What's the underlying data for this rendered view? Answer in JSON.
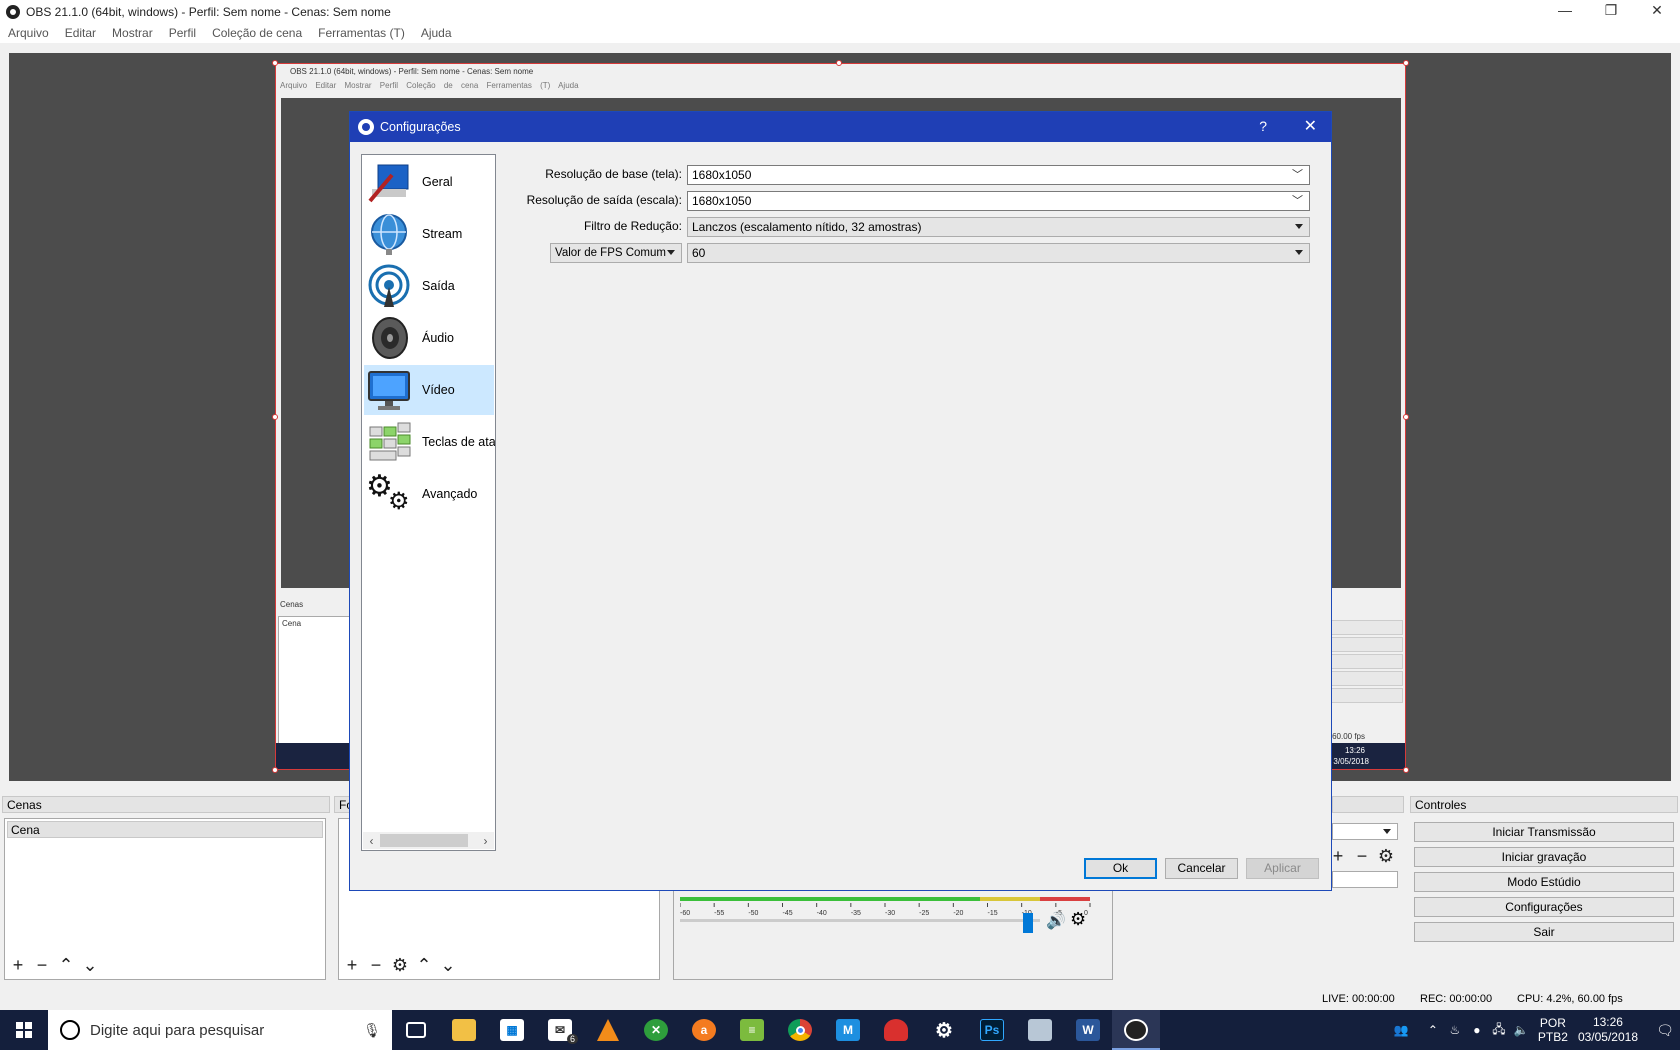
{
  "window": {
    "title": "OBS 21.1.0 (64bit, windows) - Perfil: Sem nome - Cenas: Sem nome",
    "controls": {
      "minimize": "—",
      "restore": "❐",
      "close": "✕"
    }
  },
  "menu": [
    "Arquivo",
    "Editar",
    "Mostrar",
    "Perfil",
    "Coleção de cena",
    "Ferramentas (T)",
    "Ajuda"
  ],
  "preview": {
    "nested_title": "OBS 21.1.0 (64bit, windows) - Perfil: Sem nome - Cenas: Sem nome",
    "nested_menu": "Arquivo Editar Mostrar Perfil Coleção de cena Ferramentas (T) Ajuda",
    "nested_scenes_label": "Cenas",
    "nested_scene_item": "Cena",
    "nested_time": "13:26",
    "nested_date": "3/05/2018",
    "nested_fps": ", 60.00 fps"
  },
  "docks": {
    "scenes": {
      "title": "Cenas",
      "items": [
        "Cena"
      ]
    },
    "sources": {
      "title": "Fo"
    },
    "controls": {
      "title": "Controles",
      "buttons": [
        "Iniciar Transmissão",
        "Iniciar gravação",
        "Modo Estúdio",
        "Configurações",
        "Sair"
      ]
    },
    "mixer_ticks": [
      "-60",
      "-55",
      "-50",
      "-45",
      "-40",
      "-35",
      "-30",
      "-25",
      "-20",
      "-15",
      "-10",
      "-5",
      "0"
    ],
    "mixer_level": 0.98
  },
  "status": {
    "live": "LIVE: 00:00:00",
    "rec": "REC: 00:00:00",
    "cpu": "CPU: 4.2%, 60.00 fps"
  },
  "taskbar": {
    "search_placeholder": "Digite aqui para pesquisar",
    "mail_badge": "6",
    "lang_top": "POR",
    "lang_bottom": "PTB2",
    "time": "13:26",
    "date": "03/05/2018"
  },
  "dialog": {
    "title": "Configurações",
    "help": "?",
    "close": "✕",
    "categories": [
      {
        "label": "Geral",
        "icon": "general-tools-icon"
      },
      {
        "label": "Stream",
        "icon": "globe-stream-icon"
      },
      {
        "label": "Saída",
        "icon": "broadcast-output-icon"
      },
      {
        "label": "Áudio",
        "icon": "speaker-audio-icon"
      },
      {
        "label": "Vídeo",
        "icon": "monitor-video-icon"
      },
      {
        "label": "Teclas de atalh",
        "icon": "hotkeys-icon"
      },
      {
        "label": "Avançado",
        "icon": "gears-advanced-icon"
      }
    ],
    "selected_category": "Vídeo",
    "fields": {
      "base_resolution_label": "Resolução de base (tela):",
      "base_resolution_value": "1680x1050",
      "output_resolution_label": "Resolução de saída (escala):",
      "output_resolution_value": "1680x1050",
      "downscale_filter_label": "Filtro de Redução:",
      "downscale_filter_value": "Lanczos (escalamento nítido, 32 amostras)",
      "fps_type_value": "Valor de FPS Comum",
      "fps_value": "60"
    },
    "buttons": {
      "ok": "Ok",
      "cancel": "Cancelar",
      "apply": "Aplicar"
    }
  },
  "colors": {
    "dialog_titlebar": "#1f3fb5",
    "selection": "#cce8ff",
    "taskbar": "#141f3c",
    "preview_border": "#d63a3a"
  }
}
